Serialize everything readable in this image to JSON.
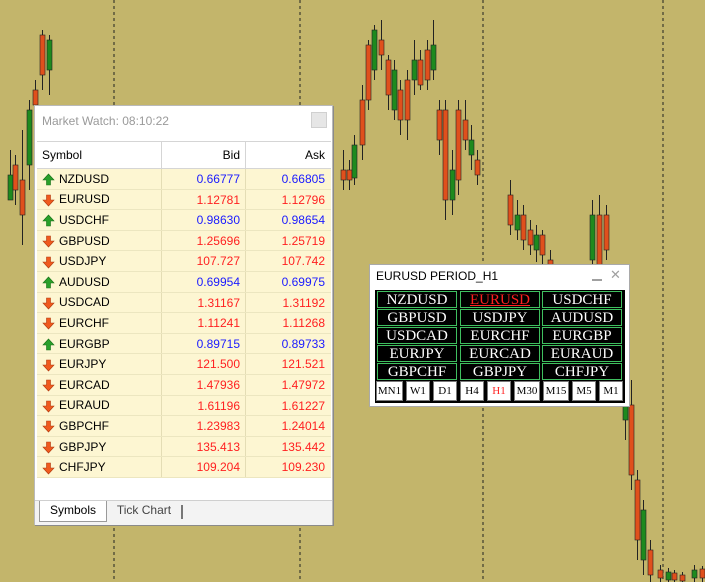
{
  "market_watch": {
    "title": "Market Watch: 08:10:22",
    "columns": {
      "symbol": "Symbol",
      "bid": "Bid",
      "ask": "Ask"
    },
    "rows": [
      {
        "symbol": "NZDUSD",
        "bid": "0.66777",
        "ask": "0.66805",
        "direction": "up"
      },
      {
        "symbol": "EURUSD",
        "bid": "1.12781",
        "ask": "1.12796",
        "direction": "down"
      },
      {
        "symbol": "USDCHF",
        "bid": "0.98630",
        "ask": "0.98654",
        "direction": "up"
      },
      {
        "symbol": "GBPUSD",
        "bid": "1.25696",
        "ask": "1.25719",
        "direction": "down"
      },
      {
        "symbol": "USDJPY",
        "bid": "107.727",
        "ask": "107.742",
        "direction": "down"
      },
      {
        "symbol": "AUDUSD",
        "bid": "0.69954",
        "ask": "0.69975",
        "direction": "up"
      },
      {
        "symbol": "USDCAD",
        "bid": "1.31167",
        "ask": "1.31192",
        "direction": "down"
      },
      {
        "symbol": "EURCHF",
        "bid": "1.11241",
        "ask": "1.11268",
        "direction": "down"
      },
      {
        "symbol": "EURGBP",
        "bid": "0.89715",
        "ask": "0.89733",
        "direction": "up"
      },
      {
        "symbol": "EURJPY",
        "bid": "121.500",
        "ask": "121.521",
        "direction": "down"
      },
      {
        "symbol": "EURCAD",
        "bid": "1.47936",
        "ask": "1.47972",
        "direction": "down"
      },
      {
        "symbol": "EURAUD",
        "bid": "1.61196",
        "ask": "1.61227",
        "direction": "down"
      },
      {
        "symbol": "GBPCHF",
        "bid": "1.23983",
        "ask": "1.24014",
        "direction": "down"
      },
      {
        "symbol": "GBPJPY",
        "bid": "135.413",
        "ask": "135.442",
        "direction": "down"
      },
      {
        "symbol": "CHFJPY",
        "bid": "109.204",
        "ask": "109.230",
        "direction": "down"
      }
    ],
    "tabs": [
      "Symbols",
      "Tick Chart"
    ],
    "active_tab": "Symbols"
  },
  "currency_panel": {
    "title": "EURUSD PERIOD_H1",
    "pairs": [
      [
        "NZDUSD",
        "EURUSD",
        "USDCHF"
      ],
      [
        "GBPUSD",
        "USDJPY",
        "AUDUSD"
      ],
      [
        "USDCAD",
        "EURCHF",
        "EURGBP"
      ],
      [
        "EURJPY",
        "EURCAD",
        "EURAUD"
      ],
      [
        "GBPCHF",
        "GBPJPY",
        "CHFJPY"
      ]
    ],
    "active_pair": "EURUSD",
    "timeframes": [
      "MN1",
      "W1",
      "D1",
      "H4",
      "H1",
      "M30",
      "M15",
      "M5",
      "M1"
    ],
    "active_timeframe": "H1"
  },
  "colors": {
    "chart_background": "#c3b56b",
    "bull_candle": "#1e8a1e",
    "bear_candle": "#e0501c",
    "bid_up": "#1a1aff",
    "bid_down": "#ff2020",
    "panel_border": "#3fbf5f"
  },
  "icons": {
    "up": "green-up-arrow-icon",
    "down": "red-down-arrow-icon"
  }
}
